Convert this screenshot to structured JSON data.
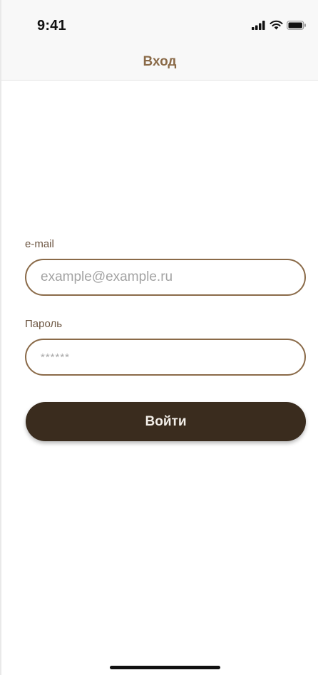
{
  "status_bar": {
    "time": "9:41",
    "icons": [
      "cellular-signal-icon",
      "wifi-icon",
      "battery-icon"
    ]
  },
  "nav": {
    "title": "Вход"
  },
  "form": {
    "email_label": "e-mail",
    "email_placeholder": "example@example.ru",
    "password_label": "Пароль",
    "password_placeholder": "******",
    "submit_label": "Войти"
  },
  "colors": {
    "accent": "#8a6a48",
    "button_bg": "#3a2c1e",
    "button_text": "#f2eee8",
    "label_text": "#6b5440"
  }
}
